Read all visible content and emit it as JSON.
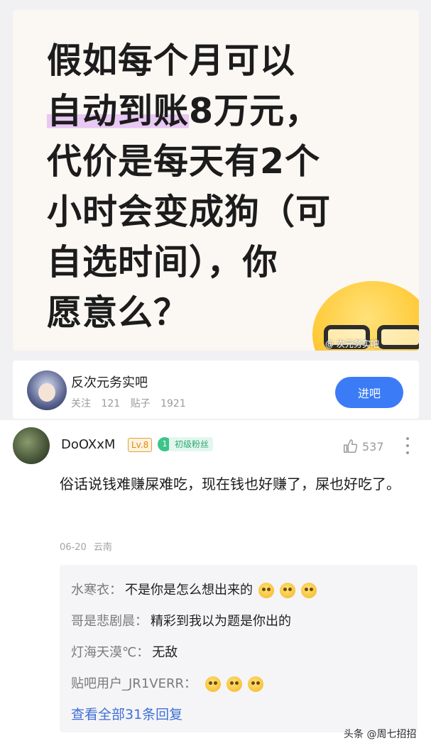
{
  "post_image": {
    "headline_parts": [
      {
        "line": "假如每个月可以",
        "highlight": ""
      },
      {
        "line": "8万元，",
        "highlight": "自动到账"
      },
      {
        "line": "代价是每天有2个",
        "highlight": ""
      },
      {
        "line": "小时会变成狗（可",
        "highlight": ""
      },
      {
        "line": "自选时间），你",
        "highlight": ""
      },
      {
        "line": "愿意么？",
        "highlight": ""
      }
    ],
    "overlay_watermark": "@ 次元务实吧",
    "accent_highlight": "#e9c8f4"
  },
  "forum": {
    "name": "反次元务实吧",
    "follow_label": "关注",
    "follow_count": "121",
    "posts_label": "贴子",
    "posts_count": "1921",
    "enter_label": "进吧",
    "enter_color": "#3b7cf6"
  },
  "comment": {
    "username": "DoOXxM",
    "level": "Lv.8",
    "fan_level": "1",
    "fan_title": "初级粉丝",
    "likes": "537",
    "text": "俗话说钱难赚屎难吃，现在钱也好赚了，屎也好吃了。",
    "date": "06-20",
    "location": "云南"
  },
  "replies": [
    {
      "author": "水寒衣",
      "text": "不是你是怎么想出来的",
      "emoji_count": 3
    },
    {
      "author": "哥是悲剧晨",
      "text": "精彩到我以为题是你出的",
      "emoji_count": 0
    },
    {
      "author": "灯海天漠℃",
      "text": "无敌",
      "emoji_count": 0
    },
    {
      "author": "贴吧用户_JR1VERR",
      "text": "",
      "emoji_count": 3
    }
  ],
  "replies_footer": {
    "view_all_label": "查看全部31条回复",
    "link_color": "#3f6fd6"
  },
  "watermark": "头条 @周七招招"
}
